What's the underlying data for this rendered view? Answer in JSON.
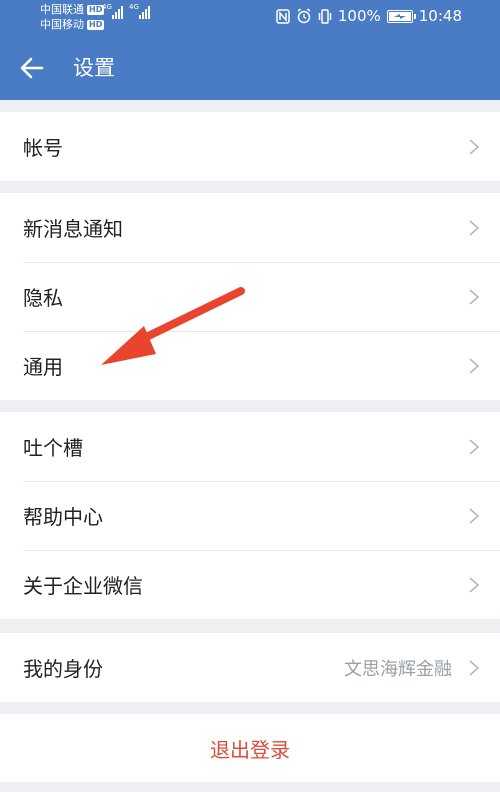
{
  "status_bar": {
    "carrier1": "中国联通",
    "carrier2": "中国移动",
    "hd_badge": "HD",
    "network1": "4G",
    "network2": "4G",
    "battery_percent": "100%",
    "time": "10:48",
    "icons": [
      "nfc-icon",
      "alarm-icon",
      "vibrate-icon",
      "battery-charging-icon"
    ]
  },
  "header": {
    "title": "设置",
    "back_icon": "arrow-left-icon",
    "color": "#4a7cc5"
  },
  "groups": [
    {
      "items": [
        {
          "label": "帐号"
        }
      ]
    },
    {
      "items": [
        {
          "label": "新消息通知"
        },
        {
          "label": "隐私"
        },
        {
          "label": "通用"
        }
      ]
    },
    {
      "items": [
        {
          "label": "吐个槽"
        },
        {
          "label": "帮助中心"
        },
        {
          "label": "关于企业微信"
        }
      ]
    },
    {
      "items": [
        {
          "label": "我的身份",
          "value": "文思海辉金融"
        }
      ]
    }
  ],
  "logout": {
    "label": "退出登录",
    "color": "#d94d3e"
  },
  "annotation": {
    "color": "#e8442e",
    "points_to": "通用"
  }
}
